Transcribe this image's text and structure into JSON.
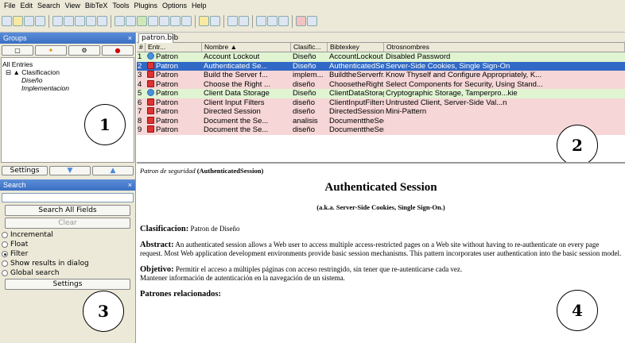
{
  "menu": [
    "File",
    "Edit",
    "Search",
    "View",
    "BibTeX",
    "Tools",
    "Plugins",
    "Options",
    "Help"
  ],
  "groups": {
    "title": "Groups",
    "close": "×",
    "tree": [
      "All Entries",
      "Clasificacion",
      "Diseño",
      "Implementacion"
    ]
  },
  "settings_label": "Settings",
  "search": {
    "title": "Search",
    "close": "×",
    "search_all": "Search All Fields",
    "clear": "Clear",
    "options": [
      {
        "label": "Incremental",
        "checked": false
      },
      {
        "label": "Float",
        "checked": false
      },
      {
        "label": "Filter",
        "checked": true
      },
      {
        "label": "Show results in dialog",
        "checked": false
      },
      {
        "label": "Global search",
        "checked": false
      }
    ],
    "settings": "Settings"
  },
  "tab": "patron.bib",
  "columns": [
    "#",
    "Entr...",
    "Nombre ▲",
    "Clasific...",
    "Bibtexkey",
    "Otrosnombres"
  ],
  "rows": [
    {
      "n": "1",
      "icon": "web",
      "entry": "Patron",
      "nombre": "Account Lockout",
      "clas": "Diseño",
      "key": "AccountLockout",
      "otros": "Disabled Password",
      "style": "green"
    },
    {
      "n": "2",
      "icon": "pdf",
      "entry": "Patron",
      "nombre": "Authenticated Se...",
      "clas": "Diseño",
      "key": "AuthenticatedSe...",
      "otros": "Server-Side Cookies, Single Sign-On",
      "style": "sel"
    },
    {
      "n": "3",
      "icon": "pdf",
      "entry": "Patron",
      "nombre": "Build the Server f...",
      "clas": "implem...",
      "key": "BuildtheServerfr...",
      "otros": "Know Thyself and Configure Appropriately, K...",
      "style": "red"
    },
    {
      "n": "4",
      "icon": "pdf",
      "entry": "Patron",
      "nombre": "Choose the Right ...",
      "clas": "diseño",
      "key": "ChoosetheRight...",
      "otros": "Select Components for Security, Using Stand...",
      "style": "red"
    },
    {
      "n": "5",
      "icon": "web",
      "entry": "Patron",
      "nombre": "Client Data Storage",
      "clas": "Diseño",
      "key": "ClientDataStorage",
      "otros": "Cryptographic Storage, Tamperpro...kie",
      "style": "green"
    },
    {
      "n": "6",
      "icon": "pdf",
      "entry": "Patron",
      "nombre": "Client Input Filters",
      "clas": "diseño",
      "key": "ClientInputFilters",
      "otros": "Untrusted Client, Server-Side Val...n",
      "style": "red"
    },
    {
      "n": "7",
      "icon": "pdf",
      "entry": "Patron",
      "nombre": "Directed Session",
      "clas": "diseño",
      "key": "DirectedSession",
      "otros": "Mini-Pattern",
      "style": "red"
    },
    {
      "n": "8",
      "icon": "pdf",
      "entry": "Patron",
      "nombre": "Document the Se...",
      "clas": "analisis",
      "key": "DocumenttheSec...",
      "otros": "",
      "style": "red"
    },
    {
      "n": "9",
      "icon": "pdf",
      "entry": "Patron",
      "nombre": "Document the Se...",
      "clas": "diseño",
      "key": "DocumenttheSer...",
      "otros": "",
      "style": "red"
    }
  ],
  "preview": {
    "header_italic": "Patron de seguridad",
    "header_key": "(AuthenticatedSession)",
    "title": "Authenticated Session",
    "aka": "(a.k.a. Server-Side Cookies, Single Sign-On.)",
    "clas_label": "Clasificacion:",
    "clas_value": "Patron de Diseño",
    "abstract_label": "Abstract:",
    "abstract": "An authenticated session allows a Web user to access multiple access-restricted pages on a Web site without having to re-authenticate on every page request. Most Web application development environments provide basic session mechanisms. This pattern incorporates user authentication into the basic session model.",
    "objetivo_label": "Objetivo:",
    "objetivo": "Permitir el acceso a múltiples páginas con acceso restringido, sin tener que re-autenticarse cada vez.",
    "objetivo2": "Mantener información de autenticación en la navegación de un sistema.",
    "patrones": "Patrones relacionados:"
  },
  "callouts": [
    "1",
    "2",
    "3",
    "4"
  ]
}
